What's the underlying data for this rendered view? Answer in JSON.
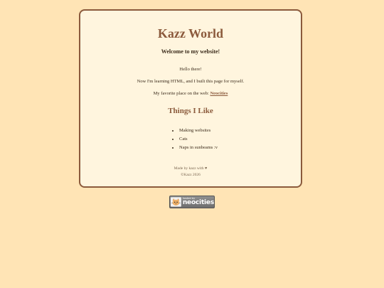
{
  "site": {
    "title": "Kazz World",
    "welcome": "Welcome to my website!",
    "paragraphs": [
      "Hello there!",
      "Now I'm learning HTML, and I built this page for myself."
    ],
    "favorite_prefix": "My favorite place on the web: ",
    "favorite_link": "Neocities"
  },
  "things": {
    "heading": "Things I Like",
    "items": [
      "Making websites",
      "Cats",
      "Naps in sunbeams :v"
    ]
  },
  "footer": {
    "line1": "Made by kazz with ♥",
    "line2": "©Kazz 2026"
  },
  "badge": {
    "small_text": "hosted by",
    "big_text": "neocities"
  },
  "colors": {
    "background": "#ffe4b5",
    "card": "#fff5de",
    "accent": "#8b5a3c"
  }
}
